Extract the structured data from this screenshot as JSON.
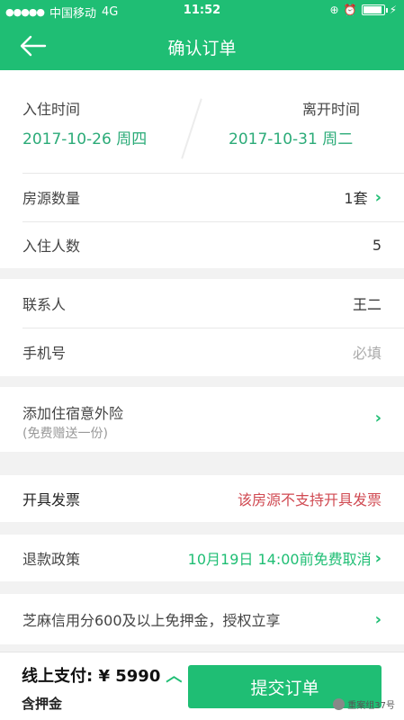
{
  "status_bar": {
    "signal": "●●●●●",
    "carrier": "中国移动",
    "network": "4G",
    "time": "11:52",
    "battery_level": 0.85
  },
  "header": {
    "title": "确认订单"
  },
  "stay": {
    "checkin_label": "入住时间",
    "checkin_date": "2017-10-26 周四",
    "checkout_label": "离开时间",
    "checkout_date": "2017-10-31 周二"
  },
  "rooms": {
    "label": "房源数量",
    "value": "1套"
  },
  "guests": {
    "label": "入住人数",
    "value": "5"
  },
  "contact": {
    "label": "联系人",
    "value": "王二"
  },
  "phone": {
    "label": "手机号",
    "placeholder": "必填"
  },
  "insurance": {
    "label": "添加住宿意外险",
    "sub": "(免费赠送一份)"
  },
  "invoice": {
    "label": "开具发票",
    "value": "该房源不支持开具发票"
  },
  "refund": {
    "label": "退款政策",
    "value": "10月19日 14:00前免费取消"
  },
  "zhima": {
    "label": "芝麻信用分600及以上免押金，授权立享"
  },
  "footer": {
    "pay_label": "线上支付: ¥ 5990",
    "deposit_label": "含押金",
    "submit_label": "提交订单",
    "watermark": "重案组37号"
  },
  "colors": {
    "accent": "#1fbe74",
    "warning": "#d04a52"
  }
}
